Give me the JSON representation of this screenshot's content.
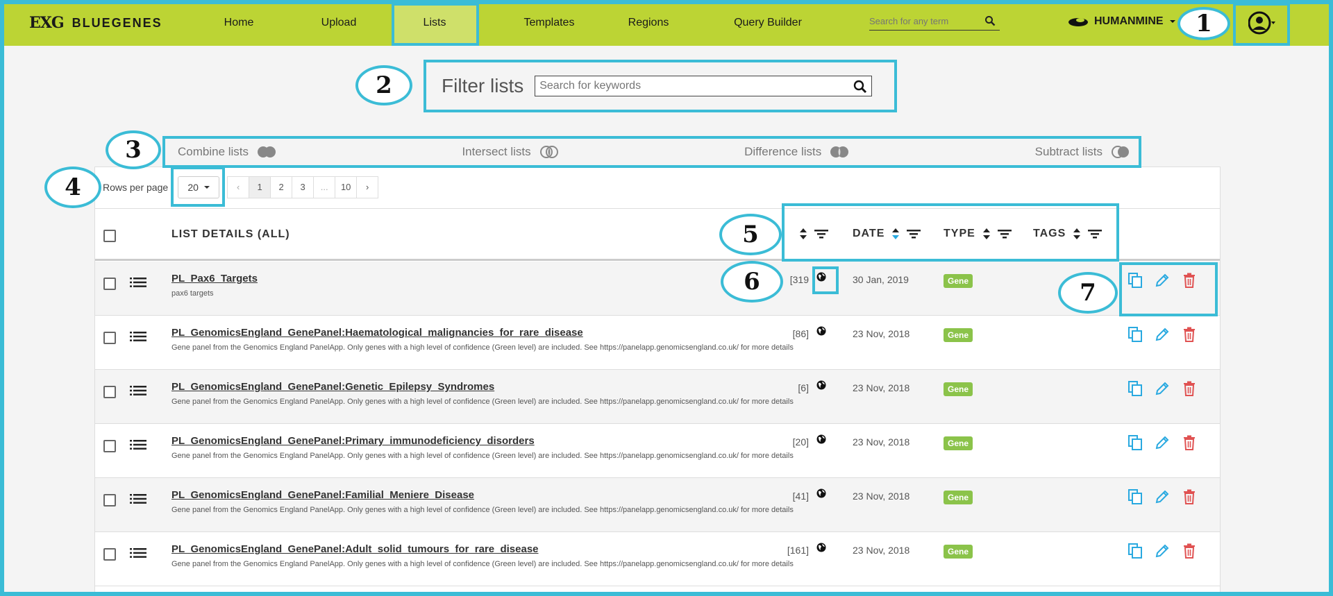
{
  "nav": {
    "logo_mark": "EXG",
    "logo_text": "BLUEGENES",
    "items": [
      {
        "label": "Home"
      },
      {
        "label": "Upload"
      },
      {
        "label": "Lists"
      },
      {
        "label": "Templates"
      },
      {
        "label": "Regions"
      },
      {
        "label": "Query Builder"
      }
    ],
    "search_placeholder": "Search for any term",
    "mine_label": "HUMANMINE"
  },
  "filter": {
    "label": "Filter lists",
    "placeholder": "Search for keywords"
  },
  "operations": [
    {
      "label": "Combine lists"
    },
    {
      "label": "Intersect lists"
    },
    {
      "label": "Difference lists"
    },
    {
      "label": "Subtract lists"
    }
  ],
  "pager": {
    "rows_label": "Rows per page",
    "rows_value": "20",
    "prev": "‹",
    "pages": [
      "1",
      "2",
      "3",
      "...",
      "10"
    ],
    "next": "›"
  },
  "table": {
    "title_header": "LIST DETAILS (ALL)",
    "date_header": "DATE",
    "type_header": "TYPE",
    "tags_header": "TAGS",
    "rows": [
      {
        "title": "PL_Pax6_Targets",
        "desc": "pax6 targets",
        "count": "[319",
        "date": "30 Jan, 2019",
        "type": "Gene"
      },
      {
        "title": "PL_GenomicsEngland_GenePanel:Haematological_malignancies_for_rare_disease",
        "desc": "Gene panel from the Genomics England PanelApp. Only genes with a high level of confidence (Green level) are included. See https://panelapp.genomicsengland.co.uk/ for more details",
        "count": "[86]",
        "date": "23 Nov, 2018",
        "type": "Gene"
      },
      {
        "title": "PL_GenomicsEngland_GenePanel:Genetic_Epilepsy_Syndromes",
        "desc": "Gene panel from the Genomics England PanelApp. Only genes with a high level of confidence (Green level) are included. See https://panelapp.genomicsengland.co.uk/ for more details",
        "count": "[6]",
        "date": "23 Nov, 2018",
        "type": "Gene"
      },
      {
        "title": "PL_GenomicsEngland_GenePanel:Primary_immunodeficiency_disorders",
        "desc": "Gene panel from the Genomics England PanelApp. Only genes with a high level of confidence (Green level) are included. See https://panelapp.genomicsengland.co.uk/ for more details",
        "count": "[20]",
        "date": "23 Nov, 2018",
        "type": "Gene"
      },
      {
        "title": "PL_GenomicsEngland_GenePanel:Familial_Meniere_Disease",
        "desc": "Gene panel from the Genomics England PanelApp. Only genes with a high level of confidence (Green level) are included. See https://panelapp.genomicsengland.co.uk/ for more details",
        "count": "[41]",
        "date": "23 Nov, 2018",
        "type": "Gene"
      },
      {
        "title": "PL_GenomicsEngland_GenePanel:Adult_solid_tumours_for_rare_disease",
        "desc": "Gene panel from the Genomics England PanelApp. Only genes with a high level of confidence (Green level) are included. See https://panelapp.genomicsengland.co.uk/ for more details",
        "count": "[161]",
        "date": "23 Nov, 2018",
        "type": "Gene"
      }
    ]
  },
  "callouts": [
    "1",
    "2",
    "3",
    "4",
    "5",
    "6",
    "7"
  ],
  "colors": {
    "nav_bg": "#bcd434",
    "nav_active": "#cfe06a",
    "annotation": "#3bbcd6",
    "tag_gene": "#8bc34a",
    "action_blue": "#29a9e0",
    "action_red": "#e05252"
  },
  "icons": [
    "search-icon",
    "caret-down-icon",
    "user-icon",
    "list-icon",
    "globe-icon",
    "copy-icon",
    "edit-icon",
    "delete-icon",
    "sort-icon",
    "filter-icon",
    "toggle-icon"
  ]
}
